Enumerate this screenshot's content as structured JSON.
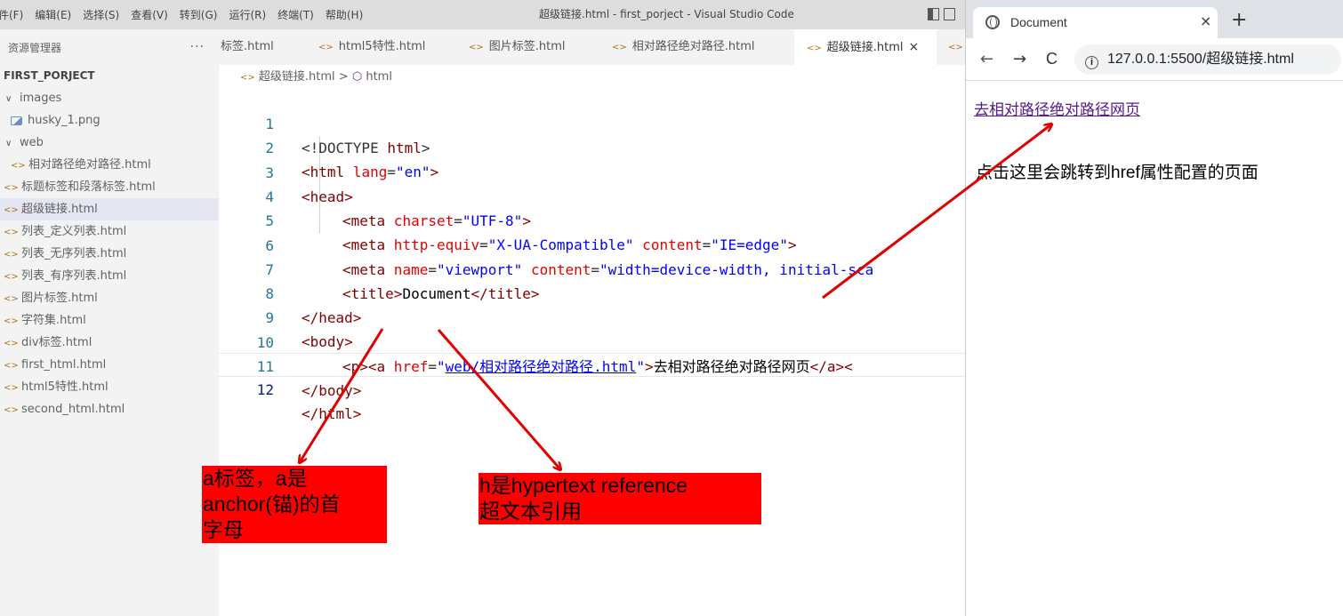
{
  "vscode": {
    "menu": [
      "件(F)",
      "编辑(E)",
      "选择(S)",
      "查看(V)",
      "转到(G)",
      "运行(R)",
      "终端(T)",
      "帮助(H)"
    ],
    "window_title": "超级链接.html - first_porject - Visual Studio Code"
  },
  "sidebar": {
    "title": "资源管理器",
    "more": "···",
    "project": "FIRST_PORJECT",
    "items": [
      {
        "label": "images"
      },
      {
        "label": "husky_1.png"
      },
      {
        "label": "web"
      },
      {
        "label": "相对路径绝对路径.html"
      },
      {
        "label": "标题标签和段落标签.html"
      },
      {
        "label": "超级链接.html"
      },
      {
        "label": "列表_定义列表.html"
      },
      {
        "label": "列表_无序列表.html"
      },
      {
        "label": "列表_有序列表.html"
      },
      {
        "label": "图片标签.html"
      },
      {
        "label": "字符集.html"
      },
      {
        "label": "div标签.html"
      },
      {
        "label": "first_html.html"
      },
      {
        "label": "html5特性.html"
      },
      {
        "label": "second_html.html"
      }
    ]
  },
  "tabs": [
    "标签.html",
    "html5特性.html",
    "图片标签.html",
    "相对路径绝对路径.html",
    "超级链接.html"
  ],
  "breadcrumb": {
    "file": "超级链接.html",
    "sep": ">",
    "node": "html"
  },
  "code": {
    "line_numbers": [
      "1",
      "2",
      "3",
      "4",
      "5",
      "6",
      "7",
      "8",
      "9",
      "10",
      "11",
      "12"
    ],
    "l1": [
      "<!DOCTYPE",
      " html",
      ">"
    ],
    "l2": [
      "<html",
      " lang",
      "=",
      "\"en\"",
      ">"
    ],
    "l3": [
      "<head>"
    ],
    "l4": [
      "<meta",
      " charset",
      "=",
      "\"UTF-8\"",
      ">"
    ],
    "l5": [
      "<meta",
      " http-equiv",
      "=",
      "\"X-UA-Compatible\"",
      " content",
      "=",
      "\"IE=edge\"",
      ">"
    ],
    "l6": [
      "<meta",
      " name",
      "=",
      "\"viewport\"",
      " content",
      "=",
      "\"width=device-width, initial-sca"
    ],
    "l7": [
      "<title>",
      "Document",
      "</title>"
    ],
    "l8": [
      "</head>"
    ],
    "l9": [
      "<body>"
    ],
    "l10": [
      "<p>",
      "<a",
      " href",
      "=",
      "\"",
      "web/相对路径绝对路径.html",
      "\"",
      ">",
      "去相对路径绝对路径网页",
      "</a><"
    ],
    "l11": [
      "</body>"
    ],
    "l12": [
      "</html>"
    ]
  },
  "browser": {
    "tab_title": "Document",
    "close": "×",
    "new_tab": "+",
    "back": "←",
    "forward": "→",
    "reload": "C",
    "info": "i",
    "url": "127.0.0.1:5500/超级链接.html",
    "link_text": "去相对路径绝对路径网页",
    "note": "点击这里会跳转到href属性配置的页面"
  },
  "annotations": {
    "a_tag": [
      "a标签，a是",
      "anchor(锚)的首",
      "字母"
    ],
    "href": [
      "h是hypertext reference",
      "超文本引用"
    ]
  },
  "colors": {
    "annotation_bg": "#ff0000",
    "arrow": "#e00000"
  }
}
